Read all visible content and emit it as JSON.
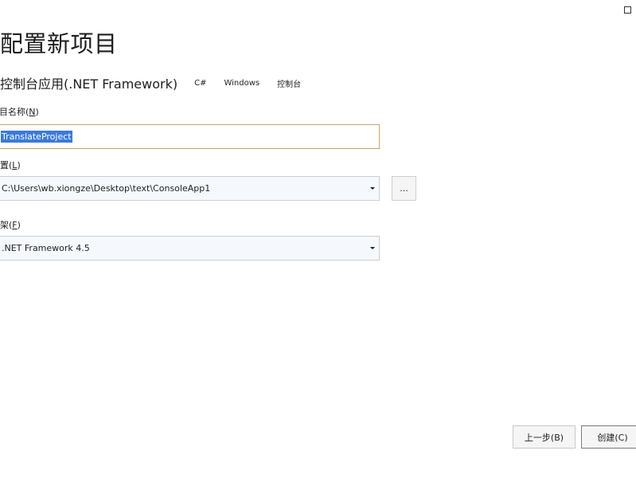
{
  "window": {
    "maximize_icon": "maximize-icon"
  },
  "page": {
    "title": "配置新项目"
  },
  "template": {
    "name": "控制台应用(.NET Framework)",
    "tags": [
      "C#",
      "Windows",
      "控制台"
    ]
  },
  "project_name": {
    "label_prefix": "项目名称(",
    "label_key": "N",
    "label_suffix": ")",
    "value": "TranslateProject"
  },
  "location": {
    "label_prefix": "位置(",
    "label_key": "L",
    "label_suffix": ")",
    "value": "C:\\Users\\wb.xiongze\\Desktop\\text\\ConsoleApp1",
    "browse_label": "..."
  },
  "framework": {
    "label_prefix": "框架(",
    "label_key": "F",
    "label_suffix": ")",
    "value": ".NET Framework 4.5"
  },
  "footer": {
    "back_label": "上一步(B)",
    "create_label": "创建(C)"
  }
}
